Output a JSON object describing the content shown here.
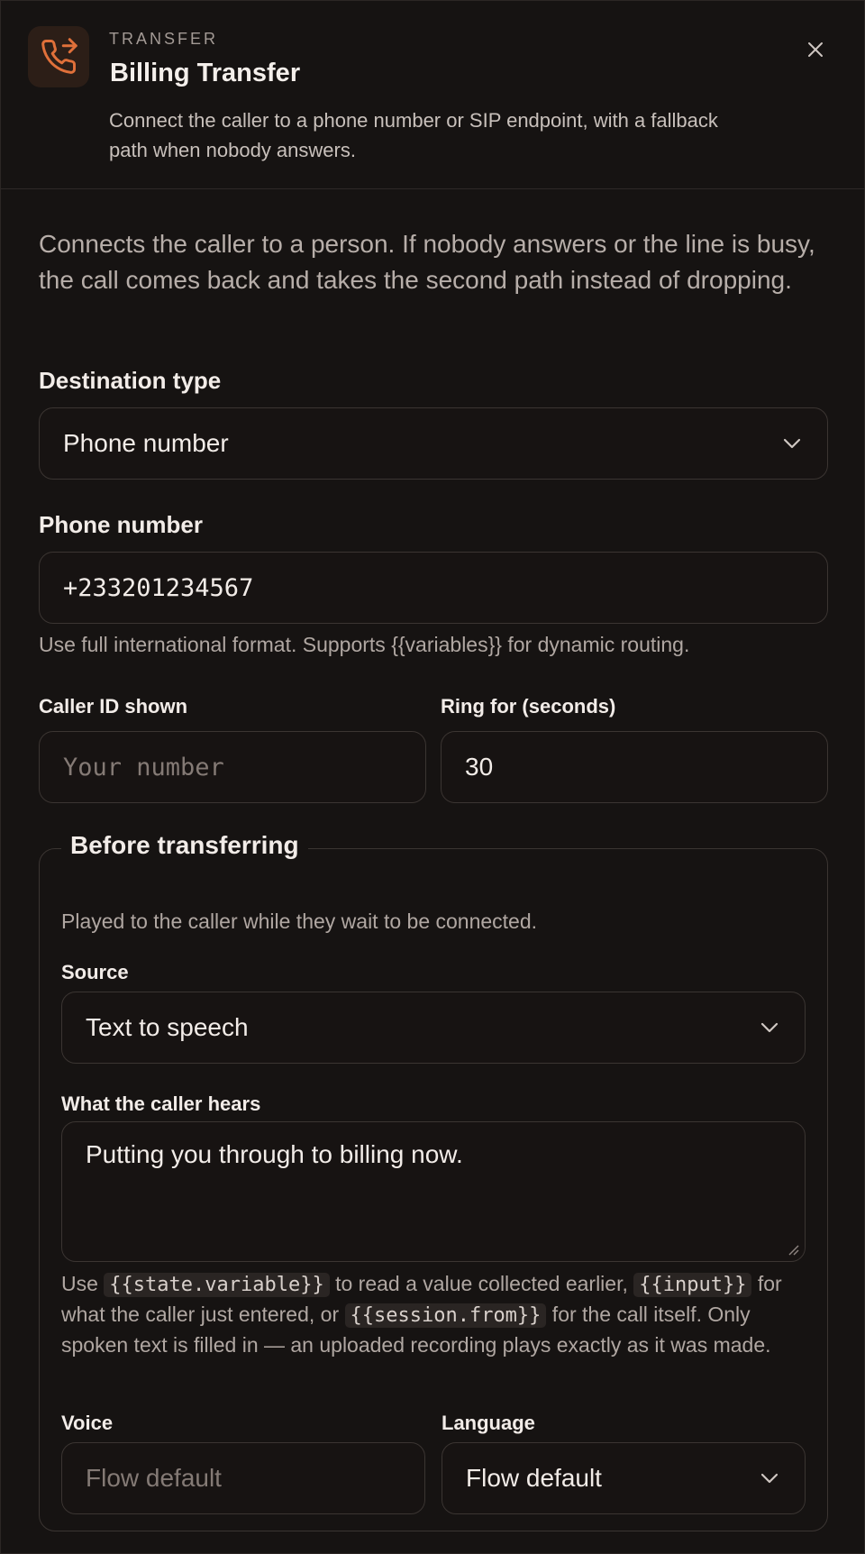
{
  "header": {
    "kicker": "TRANSFER",
    "title": "Billing Transfer",
    "subtitle": "Connect the caller to a phone number or SIP endpoint, with a fallback path when nobody answers.",
    "icon": "phone-forward-icon",
    "accent": "#e0703a"
  },
  "intro": "Connects the caller to a person. If nobody answers or the line is busy, the call comes back and takes the second path instead of dropping.",
  "destination": {
    "label": "Destination type",
    "value": "Phone number"
  },
  "phone": {
    "label": "Phone number",
    "value": "+233201234567",
    "help": "Use full international format. Supports {{variables}} for dynamic routing."
  },
  "caller_id": {
    "label": "Caller ID shown",
    "placeholder": "Your number"
  },
  "ring": {
    "label": "Ring for (seconds)",
    "value": "30"
  },
  "before": {
    "legend": "Before transferring",
    "description": "Played to the caller while they wait to be connected.",
    "source": {
      "label": "Source",
      "value": "Text to speech"
    },
    "hears": {
      "label": "What the caller hears",
      "value": "Putting you through to billing now."
    },
    "help": {
      "p1": "Use ",
      "c1": "{{state.variable}}",
      "p2": " to read a value collected earlier, ",
      "c2": "{{input}}",
      "p3": " for what the caller just entered, or ",
      "c3": "{{session.from}}",
      "p4": " for the call itself. Only spoken text is filled in — an uploaded recording plays exactly as it was made."
    },
    "voice": {
      "label": "Voice",
      "placeholder": "Flow default"
    },
    "language": {
      "label": "Language",
      "value": "Flow default"
    }
  }
}
